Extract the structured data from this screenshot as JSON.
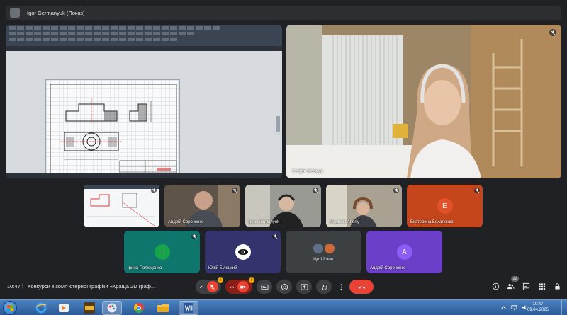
{
  "presenter": {
    "name": "Igor Germanyuk (Показ)"
  },
  "main_tile": {
    "participant": "Софія Ковчук"
  },
  "thumbnails": [
    {
      "kind": "screen"
    },
    {
      "kind": "video",
      "name": "Андрій Сороченко"
    },
    {
      "kind": "video",
      "name": "Igor Germanyuk"
    },
    {
      "kind": "video",
      "name": "Neiyubin Andriy"
    },
    {
      "kind": "avatar",
      "name": "Екатерина Бохаленко",
      "initial": "E",
      "color": "#c5461c"
    },
    {
      "kind": "avatar",
      "name": "Ірина Полюценко",
      "initial": "I",
      "color": "#0f766e"
    },
    {
      "kind": "avatar",
      "name": "Юрій Білецкий",
      "initial": "",
      "color": "#3b3a7a"
    },
    {
      "kind": "more",
      "name": "Ще 12 чол."
    },
    {
      "kind": "avatar",
      "name": "Андрій Сороченко",
      "initial": "A",
      "color": "#6b3fc8"
    }
  ],
  "meeting": {
    "time": "10:47",
    "separator": "|",
    "title": "Конкурси з комп'ютерної графіки «Краща 2D граф...",
    "participants_count": "22"
  },
  "controls": {
    "mic_warning": "!",
    "cam_warning": "!",
    "icons": [
      "chevron-up-icon",
      "microphone-off-icon",
      "chevron-up-icon",
      "camera-off-icon",
      "captions-icon",
      "emoji-icon",
      "present-icon",
      "raise-hand-icon",
      "more-options-icon",
      "end-call-icon"
    ],
    "right_icons": [
      "info-icon",
      "people-icon",
      "chat-icon",
      "activities-icon",
      "lock-icon"
    ]
  },
  "taskbar": {
    "time": "10:47",
    "date": "09.04.2025",
    "apps": [
      "internet-explorer-icon",
      "media-player-icon",
      "game-icon",
      "paint-icon",
      "chrome-icon",
      "file-explorer-icon",
      "word-icon"
    ]
  }
}
